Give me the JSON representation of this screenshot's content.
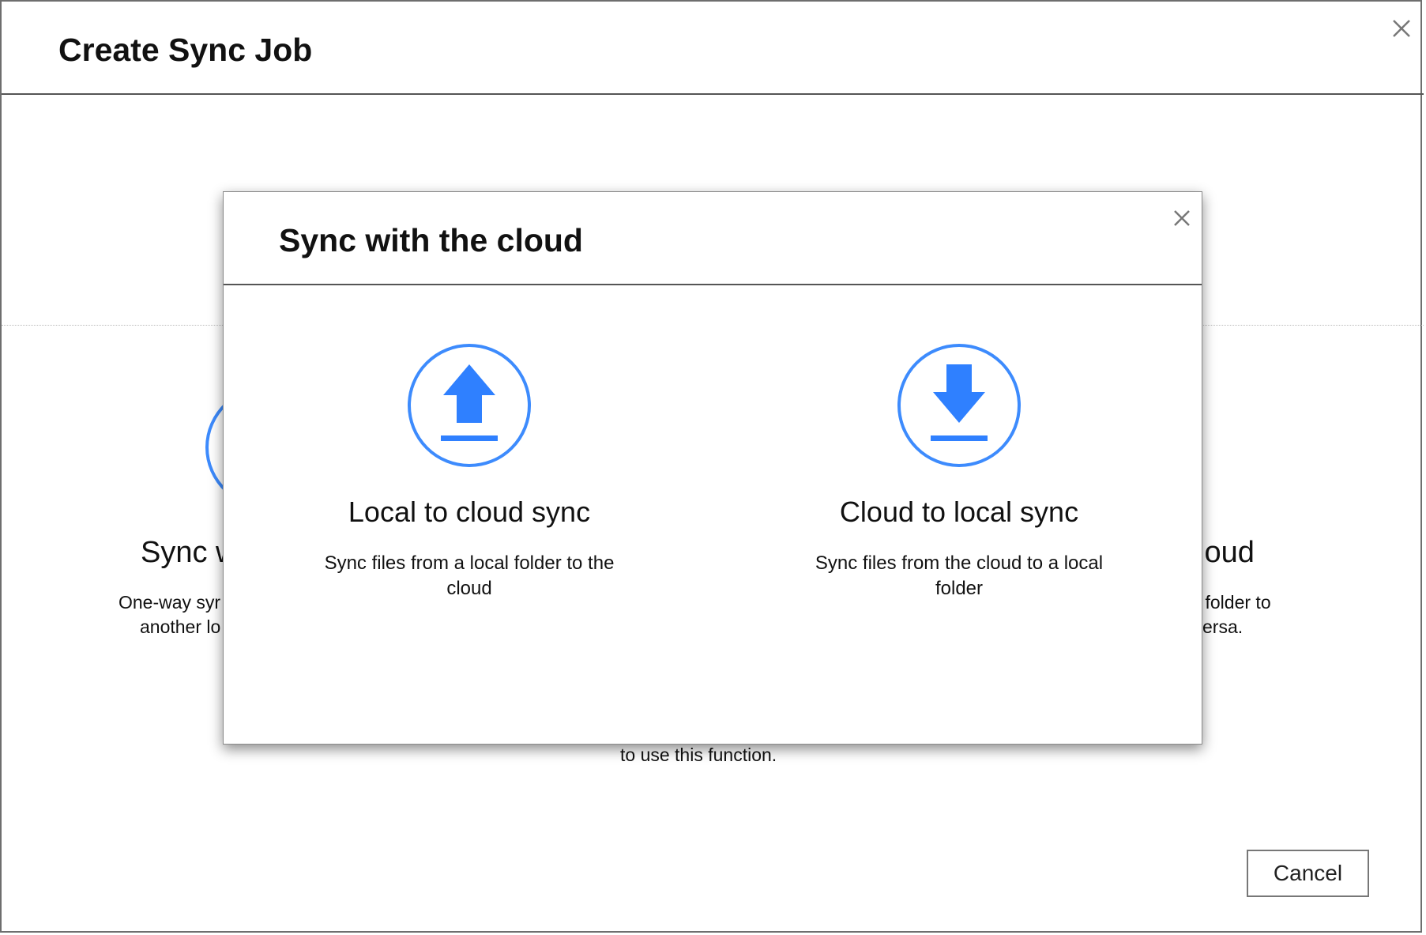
{
  "outer_dialog": {
    "title": "Create Sync Job",
    "background_card_left": {
      "title_partial": "Sync w",
      "desc_line1_partial": "One-way syr",
      "desc_line2_partial": "another lo"
    },
    "background_card_right": {
      "title_partial": "loud",
      "desc_line1_partial": "l folder to",
      "desc_line2_partial": "ersa."
    },
    "background_note_partial": "to use this function.",
    "cancel_label": "Cancel"
  },
  "modal": {
    "title": "Sync with the cloud",
    "options": [
      {
        "title": "Local to cloud sync",
        "description": "Sync files from a local folder to the cloud",
        "icon": "upload-icon"
      },
      {
        "title": "Cloud to local sync",
        "description": "Sync files from the cloud to a local folder",
        "icon": "download-icon"
      }
    ]
  },
  "colors": {
    "accent": "#3d8bfd",
    "icon_fill": "#2f80ff"
  }
}
